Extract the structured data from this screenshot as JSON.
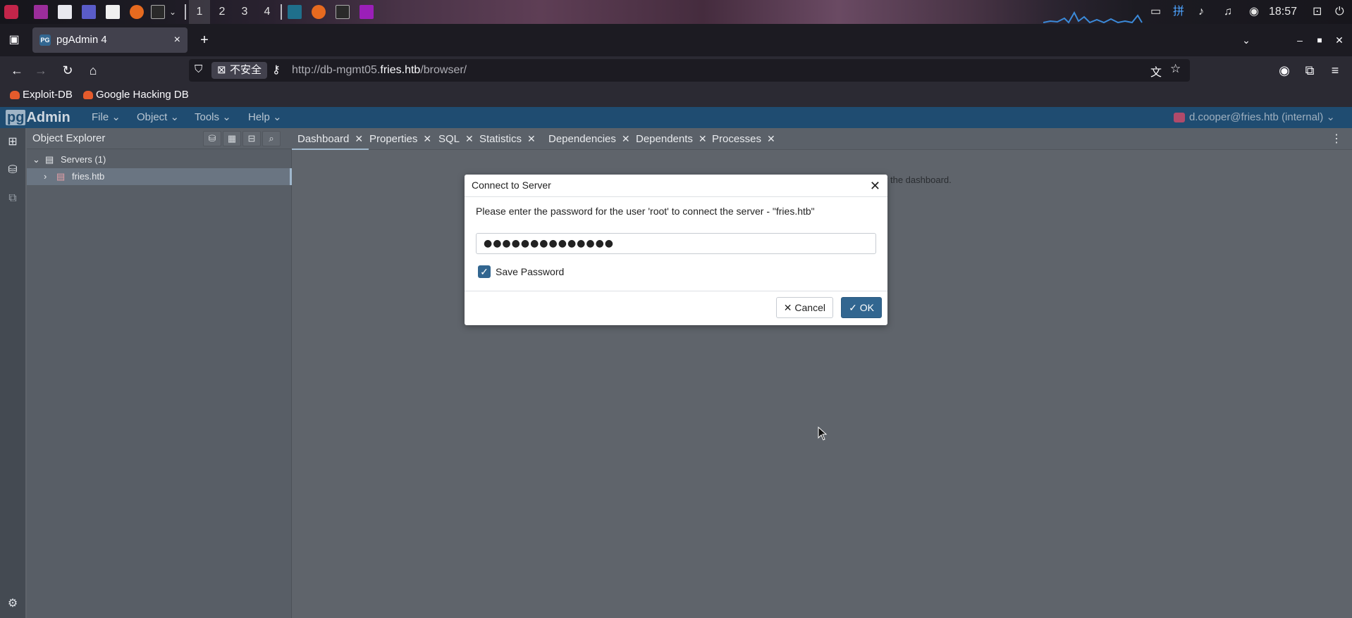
{
  "taskbar": {
    "workspaces": [
      "1",
      "2",
      "3",
      "4"
    ],
    "clock": "18:57"
  },
  "browser": {
    "tab_title": "pgAdmin 4",
    "tab_close": "×",
    "new_tab": "+",
    "insecure_label": "不安全",
    "url_prefix": "http://db-mgmt05.",
    "url_host": "fries.htb",
    "url_path": "/browser/",
    "bookmarks": [
      "Exploit-DB",
      "Google Hacking DB"
    ]
  },
  "pgadmin": {
    "logo_pg": "pg",
    "logo_text": "Admin",
    "menus": [
      "File",
      "Object",
      "Tools",
      "Help"
    ],
    "user": "d.cooper@fries.htb (internal)",
    "explorer_title": "Object Explorer",
    "tree": {
      "servers": "Servers (1)",
      "server_item": "fries.htb"
    },
    "tabs": [
      "Dashboard",
      "Properties",
      "SQL",
      "Statistics",
      "Dependencies",
      "Dependents",
      "Processes"
    ],
    "dashboard_hint": "w the dashboard."
  },
  "dialog": {
    "title": "Connect to Server",
    "message": "Please enter the password for the user 'root' to connect the server - \"fries.htb\"",
    "password_value": "●●●●●●●●●●●●●●",
    "save_password_label": "Save Password",
    "cancel_label": "Cancel",
    "ok_label": "OK"
  },
  "colors": {
    "pg_header": "#1f4c71",
    "primary_button": "#326690",
    "workspace_bg": "#5f646b"
  }
}
